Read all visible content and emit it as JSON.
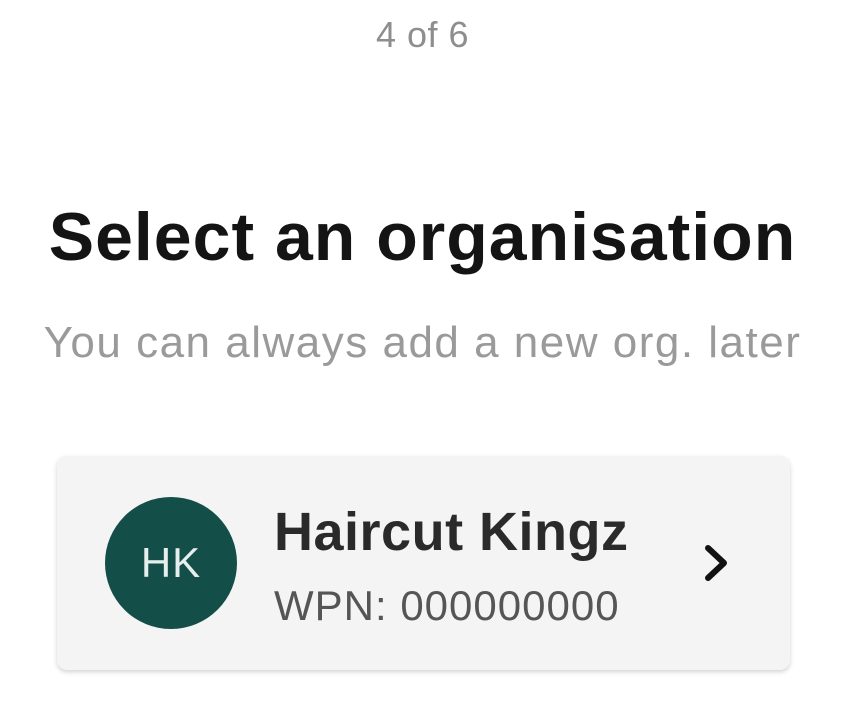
{
  "progress": {
    "step_text": "4 of 6"
  },
  "header": {
    "title": "Select an organisation",
    "subtitle": "You can always add a new org. later"
  },
  "organisations": [
    {
      "initials": "HK",
      "name": "Haircut Kingz",
      "wpn": "WPN: 000000000",
      "avatar_color": "#134e48",
      "action_icon": "chevron-right-icon"
    }
  ]
}
